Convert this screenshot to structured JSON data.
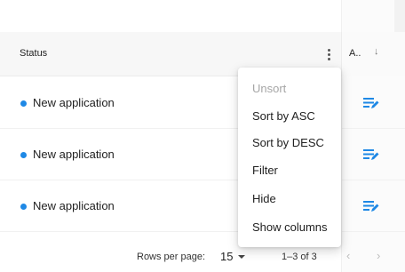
{
  "header": {
    "status_label": "Status",
    "col_a_label": "A..",
    "sort_arrow": "↓"
  },
  "rows": [
    {
      "status": "New application",
      "dot_color": "#1e88e5",
      "action_icon": "edit-list-icon"
    },
    {
      "status": "New application",
      "dot_color": "#1e88e5",
      "action_icon": "edit-list-icon"
    },
    {
      "status": "New application",
      "dot_color": "#1e88e5",
      "action_icon": "edit-list-icon"
    }
  ],
  "column_menu": {
    "items": [
      {
        "label": "Unsort",
        "disabled": true
      },
      {
        "label": "Sort by ASC",
        "disabled": false
      },
      {
        "label": "Sort by DESC",
        "disabled": false
      },
      {
        "label": "Filter",
        "disabled": false
      },
      {
        "label": "Hide",
        "disabled": false
      },
      {
        "label": "Show columns",
        "disabled": false
      }
    ]
  },
  "footer": {
    "rows_per_page_label": "Rows per page:",
    "rows_per_page_value": "15",
    "page_info": "1–3 of 3",
    "prev": "‹",
    "next": "›"
  },
  "colors": {
    "accent": "#1e88e5",
    "icon_blue": "#1e88e5"
  }
}
